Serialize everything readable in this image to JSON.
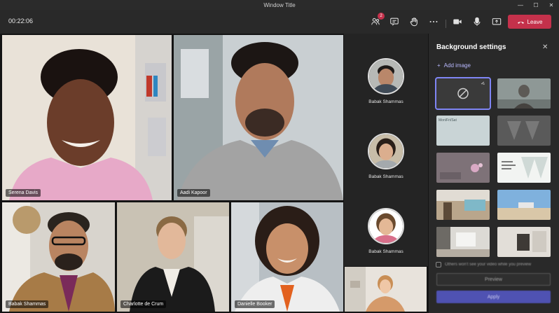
{
  "window": {
    "title": "Window Title",
    "controls": {
      "minimize": "—",
      "maximize": "☐",
      "close": "✕"
    }
  },
  "toolbar": {
    "timer": "00:22:06",
    "participants_badge": "2",
    "leave_label": "Leave",
    "icons": [
      "people-icon",
      "chat-icon",
      "raise-hand-icon",
      "more-icon",
      "camera-icon",
      "mic-icon",
      "share-icon",
      "phone-icon"
    ]
  },
  "stage": {
    "participants": [
      {
        "name": "Serena Davis"
      },
      {
        "name": "Aadi Kapoor"
      },
      {
        "name": "Babak Shammas"
      },
      {
        "name": "Charlotte de Crum"
      },
      {
        "name": "Danielle Booker"
      }
    ]
  },
  "roster": {
    "items": [
      {
        "name": "Babak Shammas"
      },
      {
        "name": "Babak Shammas"
      },
      {
        "name": "Babak Shammas"
      }
    ]
  },
  "background_panel": {
    "title": "Background settings",
    "close": "✕",
    "add_image": "Add image",
    "thumbnail_label": "Mon/Fri/Sat",
    "mirror_text": "Others won't see your video while you preview",
    "preview_label": "Preview",
    "apply_label": "Apply"
  },
  "colors": {
    "leave": "#c4314b",
    "accent": "#7f85f5",
    "apply": "#4f52b2",
    "panel": "#292929"
  }
}
